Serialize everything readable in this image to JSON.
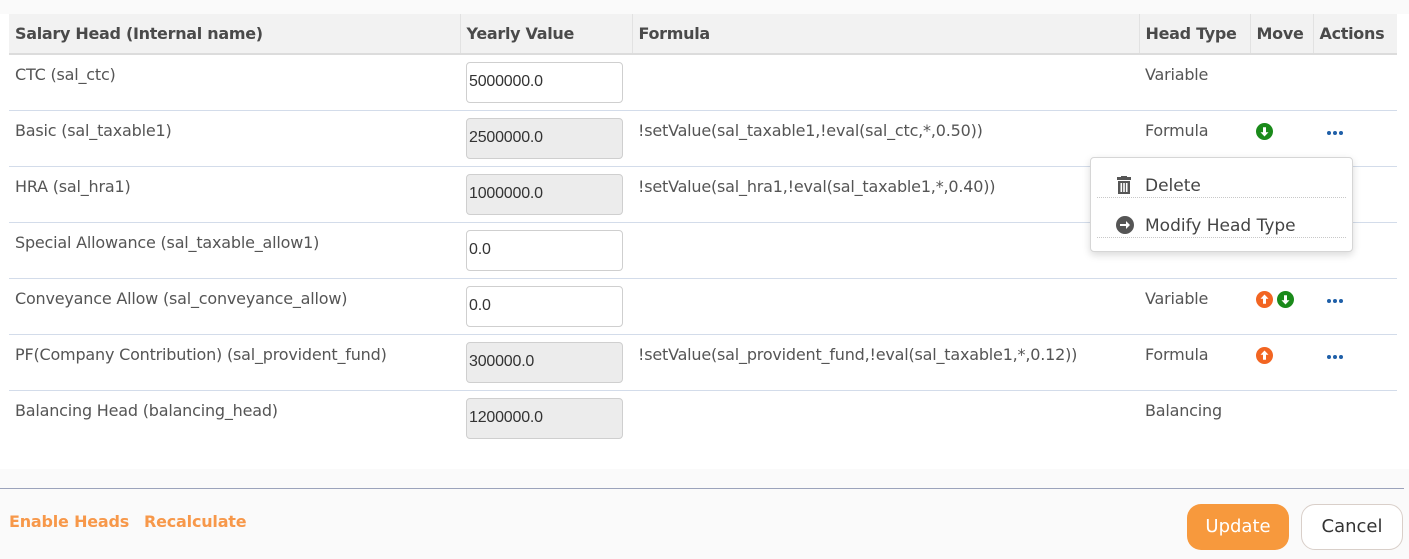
{
  "table": {
    "headers": {
      "salary_head": "Salary Head (Internal name)",
      "yearly_value": "Yearly Value",
      "formula": "Formula",
      "head_type": "Head Type",
      "move": "Move",
      "actions": "Actions"
    },
    "rows": [
      {
        "name": "CTC (sal_ctc)",
        "value": "5000000.0",
        "readonly": false,
        "formula": "",
        "head_type": "Variable",
        "move_up": false,
        "move_down": false,
        "actions": false
      },
      {
        "name": "Basic (sal_taxable1)",
        "value": "2500000.0",
        "readonly": true,
        "formula": "!setValue(sal_taxable1,!eval(sal_ctc,*,0.50))",
        "head_type": "Formula",
        "move_up": false,
        "move_down": true,
        "actions": true
      },
      {
        "name": "HRA (sal_hra1)",
        "value": "1000000.0",
        "readonly": true,
        "formula": "!setValue(sal_hra1,!eval(sal_taxable1,*,0.40))",
        "head_type": "",
        "move_up": false,
        "move_down": false,
        "actions": false
      },
      {
        "name": "Special Allowance (sal_taxable_allow1)",
        "value": "0.0",
        "readonly": false,
        "formula": "",
        "head_type": "",
        "move_up": true,
        "move_down": true,
        "actions": false
      },
      {
        "name": "Conveyance Allow (sal_conveyance_allow)",
        "value": "0.0",
        "readonly": false,
        "formula": "",
        "head_type": "Variable",
        "move_up": true,
        "move_down": true,
        "actions": true
      },
      {
        "name": "PF(Company Contribution) (sal_provident_fund)",
        "value": "300000.0",
        "readonly": true,
        "formula": "!setValue(sal_provident_fund,!eval(sal_taxable1,*,0.12))",
        "head_type": "Formula",
        "move_up": true,
        "move_down": false,
        "actions": true
      },
      {
        "name": "Balancing Head (balancing_head)",
        "value": "1200000.0",
        "readonly": true,
        "formula": "",
        "head_type": "Balancing",
        "move_up": false,
        "move_down": false,
        "actions": false
      }
    ]
  },
  "actions_menu": {
    "items": [
      {
        "label": "Delete",
        "icon": "trash-icon"
      },
      {
        "label": "Modify Head Type",
        "icon": "arrow-circle-right-icon"
      }
    ]
  },
  "footer": {
    "enable_heads": "Enable Heads",
    "recalculate": "Recalculate",
    "update": "Update",
    "cancel": "Cancel"
  },
  "colors": {
    "accent_orange": "#f7993d",
    "move_up": "#f26522",
    "move_down": "#1a8a1a",
    "actions_dots": "#1f5fa8"
  }
}
